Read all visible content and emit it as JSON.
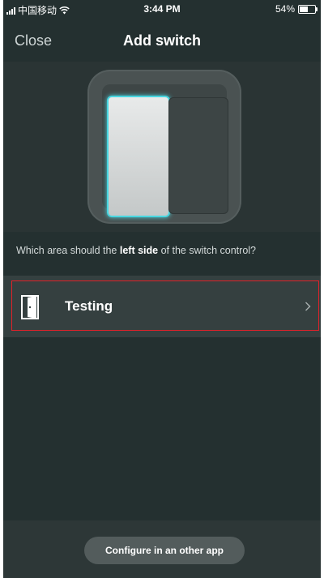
{
  "status_bar": {
    "carrier": "中国移动",
    "time": "3:44 PM",
    "battery_percent_text": "54%",
    "battery_level": 0.54,
    "icons": [
      "signal-icon",
      "wifi-icon",
      "battery-icon"
    ]
  },
  "nav": {
    "close_label": "Close",
    "title": "Add switch"
  },
  "illustration": {
    "highlight_color": "#48d6e0",
    "selected_side": "left"
  },
  "question": {
    "prefix": "Which area should the ",
    "emphasis": "left side",
    "suffix": " of the switch control?"
  },
  "rooms": [
    {
      "name": "Testing",
      "icon": "door-icon"
    }
  ],
  "footer": {
    "config_button_label": "Configure in an other app"
  },
  "colors": {
    "background": "#243030",
    "row_background": "#354040",
    "selection_outline": "#e0222a"
  }
}
